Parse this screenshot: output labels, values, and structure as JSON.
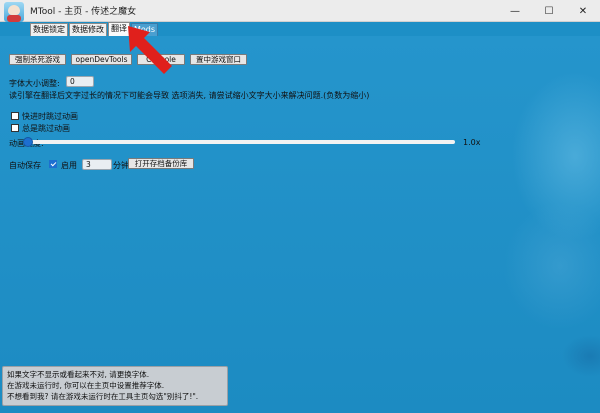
{
  "window": {
    "title": "MTool - 主页 - 传述之魔女",
    "minimize": "—",
    "maximize": "☐",
    "close": "✕"
  },
  "tabs": [
    {
      "label": "数据锁定"
    },
    {
      "label": "数据修改"
    },
    {
      "label": "翻译",
      "selected": true
    },
    {
      "label": "Mods"
    }
  ],
  "toolbar": {
    "kill_game": "强制杀死游戏",
    "open_devtools": "openDevTools",
    "console": "Console",
    "center_window": "置中游戏窗口"
  },
  "font_size": {
    "label": "字体大小调整:",
    "value": "0",
    "hint": "读引擎在翻译后文字过长的情况下可能会导致 选项消失, 请尝试缩小文字大小来解决问题.(负数为缩小)"
  },
  "options": {
    "fast_skip_animation": {
      "label": "快进时跳过动画",
      "checked": false
    },
    "always_skip_animation": {
      "label": "总是跳过动画",
      "checked": false
    }
  },
  "animation_speed": {
    "label": "动画速度:",
    "value_text": "1.0x",
    "fraction": 0.0
  },
  "autosave": {
    "label": "自动保存",
    "enabled": true,
    "enable_label": "启用",
    "minutes": "3",
    "unit": "分钟",
    "open_backup": "打开存档备份库"
  },
  "tips": [
    "如果文字不显示或看起来不对, 请更换字体.",
    "在游戏未运行时, 你可以在主页中设置推荐字体.",
    "不想看到我? 请在游戏未运行时在工具主页勾选\"别抖了!\"."
  ],
  "colors": {
    "background": "#1d8fc6",
    "accent": "#1d6fd0",
    "arrow": "#e0201c"
  }
}
